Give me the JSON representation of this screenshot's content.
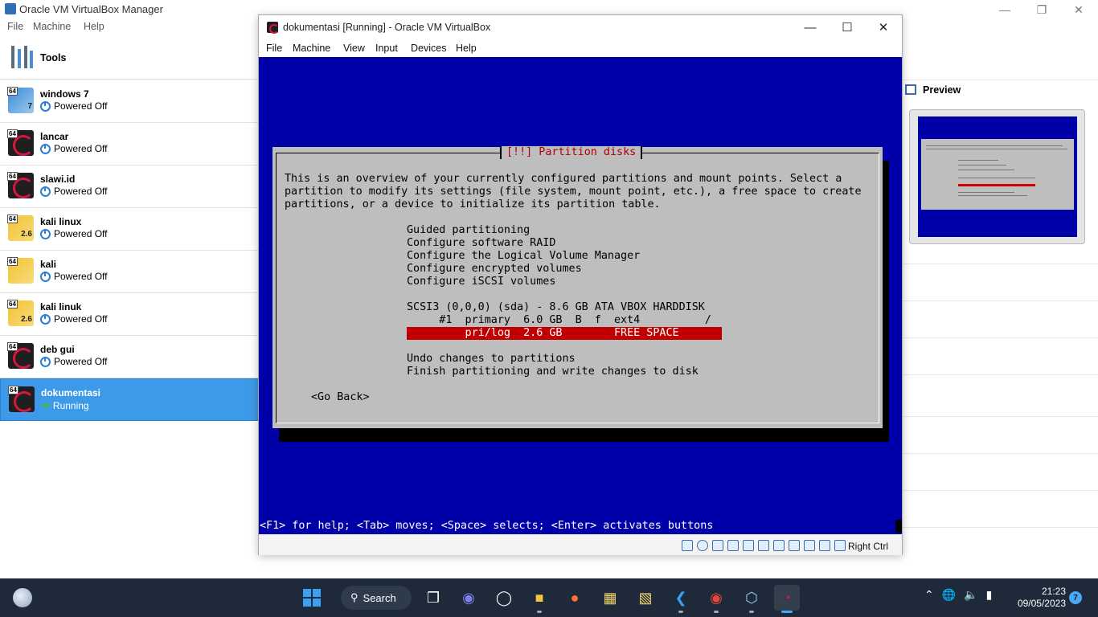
{
  "manager": {
    "title": "Oracle VM VirtualBox Manager",
    "menu": [
      "File",
      "Machine",
      "Help"
    ],
    "tools_label": "Tools",
    "vms": [
      {
        "name": "windows 7",
        "status": "Powered Off",
        "icon": "windows-7-os-icon",
        "version_badge": "7"
      },
      {
        "name": "lancar",
        "status": "Powered Off",
        "icon": "debian-os-icon",
        "version_badge": ""
      },
      {
        "name": "slawi.id",
        "status": "Powered Off",
        "icon": "debian-os-icon",
        "version_badge": ""
      },
      {
        "name": "kali linux",
        "status": "Powered Off",
        "icon": "linux-2-6-os-icon",
        "version_badge": "2.6"
      },
      {
        "name": "kali",
        "status": "Powered Off",
        "icon": "linux-os-icon",
        "version_badge": ""
      },
      {
        "name": "kali linuk",
        "status": "Powered Off",
        "icon": "linux-2-6-os-icon",
        "version_badge": "2.6"
      },
      {
        "name": "deb gui",
        "status": "Powered Off",
        "icon": "debian-os-icon",
        "version_badge": ""
      },
      {
        "name": "dokumentasi",
        "status": "Running",
        "icon": "debian-os-icon",
        "version_badge": "",
        "selected": true
      }
    ],
    "arch_badge": "64",
    "preview_label": "Preview"
  },
  "vm_window": {
    "title": "dokumentasi [Running] - Oracle VM VirtualBox",
    "menu": [
      "File",
      "Machine",
      "View",
      "Input",
      "Devices",
      "Help"
    ],
    "host_key": "Right Ctrl"
  },
  "installer": {
    "dialog_title": "[!!] Partition disks",
    "intro_lines": [
      "This is an overview of your currently configured partitions and mount points. Select a",
      "partition to modify its settings (file system, mount point, etc.), a free space to create",
      "partitions, or a device to initialize its partition table."
    ],
    "menu_options": [
      "Guided partitioning",
      "Configure software RAID",
      "Configure the Logical Volume Manager",
      "Configure encrypted volumes",
      "Configure iSCSI volumes"
    ],
    "disk_line": "SCSI3 (0,0,0) (sda) - 8.6 GB ATA VBOX HARDDISK",
    "partition_line": "     #1  primary  6.0 GB  B  f  ext4          /",
    "selected_line": "         pri/log  2.6 GB        FREE SPACE",
    "finish_options": [
      "Undo changes to partitions",
      "Finish partitioning and write changes to disk"
    ],
    "go_back": "<Go Back>",
    "help_line": "<F1> for help; <Tab> moves; <Space> selects; <Enter> activates buttons"
  },
  "taskbar": {
    "search_label": "Search",
    "time": "21:23",
    "date": "09/05/2023",
    "notification_count": "7"
  },
  "colors": {
    "installer_bg": "#0000a8",
    "dialog_bg": "#bebebe",
    "selection": "#c00000",
    "title_red": "#b20000",
    "vm_selected": "#3d9ae8",
    "taskbar": "#1e2a3a"
  }
}
